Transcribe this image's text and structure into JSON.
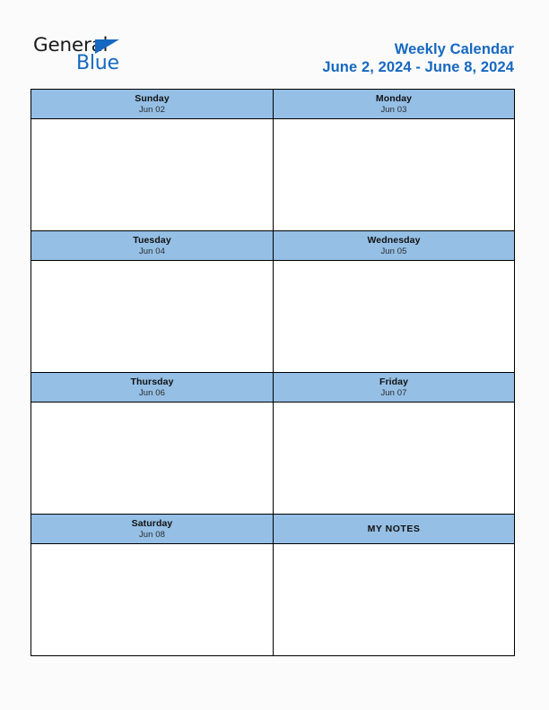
{
  "brand": {
    "word_one": "General",
    "word_two": "Blue",
    "triangle_icon": "brand-triangle-icon",
    "accent_color": "#1668c0",
    "text_color": "#1b1b1b"
  },
  "header": {
    "title": "Weekly Calendar",
    "date_range": "June 2, 2024 - June 8, 2024",
    "title_color": "#1668c0"
  },
  "theme": {
    "header_cell_background": "#95bfe5",
    "body_cell_background": "#ffffff",
    "border_color": "#000000",
    "page_background": "#fbfbfb"
  },
  "calendar": {
    "rows": [
      {
        "left": {
          "type": "day",
          "day_name": "Sunday",
          "date_label": "Jun 02",
          "entry": ""
        },
        "right": {
          "type": "day",
          "day_name": "Monday",
          "date_label": "Jun 03",
          "entry": ""
        }
      },
      {
        "left": {
          "type": "day",
          "day_name": "Tuesday",
          "date_label": "Jun 04",
          "entry": ""
        },
        "right": {
          "type": "day",
          "day_name": "Wednesday",
          "date_label": "Jun 05",
          "entry": ""
        }
      },
      {
        "left": {
          "type": "day",
          "day_name": "Thursday",
          "date_label": "Jun 06",
          "entry": ""
        },
        "right": {
          "type": "day",
          "day_name": "Friday",
          "date_label": "Jun 07",
          "entry": ""
        }
      },
      {
        "left": {
          "type": "day",
          "day_name": "Saturday",
          "date_label": "Jun 08",
          "entry": ""
        },
        "right": {
          "type": "notes",
          "title": "MY NOTES",
          "entry": ""
        }
      }
    ]
  }
}
